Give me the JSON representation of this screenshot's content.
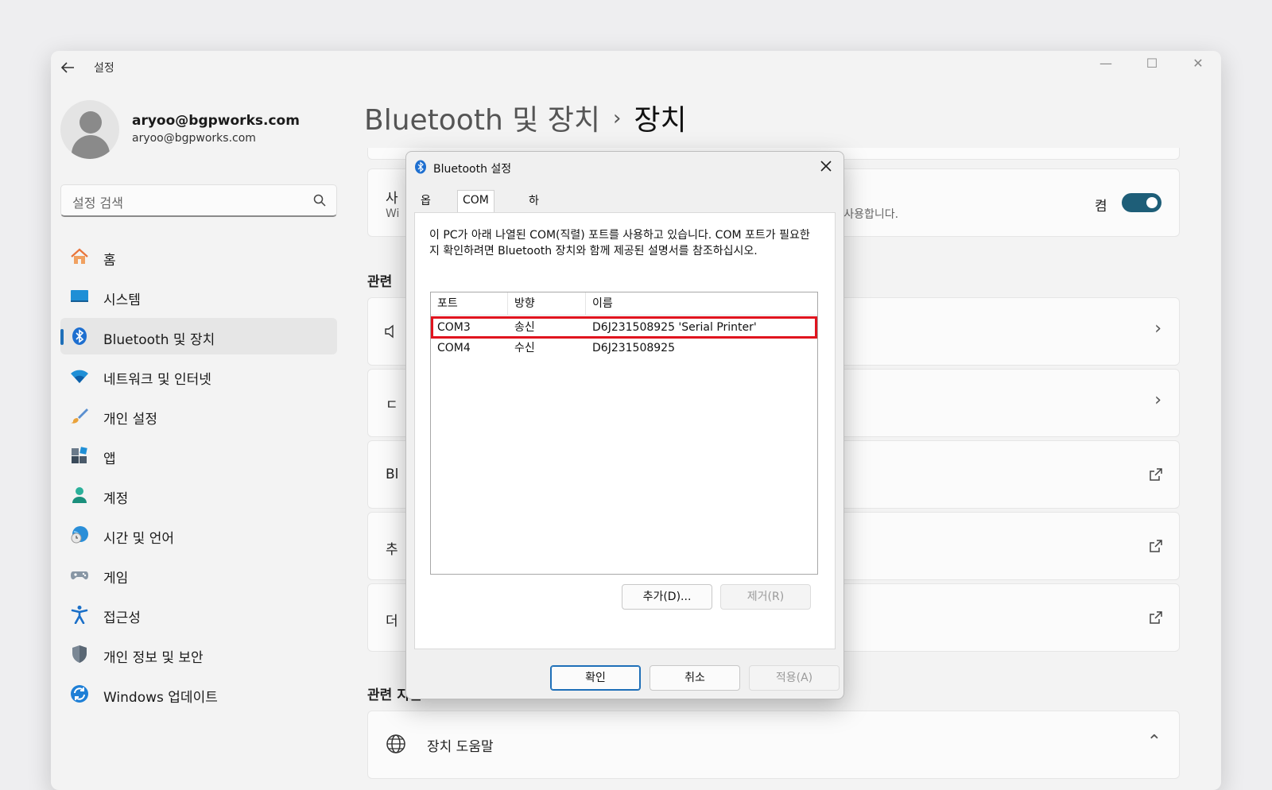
{
  "window": {
    "title": "설정",
    "minimize_glyph": "—",
    "maximize_glyph": "☐",
    "close_glyph": "✕"
  },
  "user": {
    "email": "aryoo@bgpworks.com",
    "sub_email": "aryoo@bgpworks.com"
  },
  "search": {
    "placeholder": "설정 검색"
  },
  "sidebar": {
    "items": [
      {
        "label": "홈",
        "icon": "home-icon"
      },
      {
        "label": "시스템",
        "icon": "system-icon"
      },
      {
        "label": "Bluetooth 및 장치",
        "icon": "bluetooth-icon",
        "active": true
      },
      {
        "label": "네트워크 및 인터넷",
        "icon": "wifi-icon"
      },
      {
        "label": "개인 설정",
        "icon": "brush-icon"
      },
      {
        "label": "앱",
        "icon": "apps-icon"
      },
      {
        "label": "계정",
        "icon": "account-icon"
      },
      {
        "label": "시간 및 언어",
        "icon": "globe-clock-icon"
      },
      {
        "label": "게임",
        "icon": "gamepad-icon"
      },
      {
        "label": "접근성",
        "icon": "accessibility-icon"
      },
      {
        "label": "개인 정보 및 보안",
        "icon": "shield-icon"
      },
      {
        "label": "Windows 업데이트",
        "icon": "update-icon"
      }
    ]
  },
  "breadcrumb": {
    "parent": "Bluetooth 및 장치",
    "separator": "›",
    "current": "장치"
  },
  "main": {
    "toggle_card": {
      "title_partial": "사",
      "sub_partial": "Wi",
      "sub_right": "오를 사용합니다.",
      "toggle_label": "켬",
      "toggle_on": true
    },
    "related_title_partial": "관련",
    "cards": [
      {
        "label_partial": "",
        "trail": "chevron-right"
      },
      {
        "label_partial": "ㄷ",
        "trail": "chevron-right"
      },
      {
        "label_partial": "Bl",
        "trail": "external-link"
      },
      {
        "label_partial": "추",
        "trail": "external-link"
      },
      {
        "label_partial": "더",
        "trail": "external-link"
      }
    ],
    "support_title": "관련 지원",
    "support_item": "장치 도움말"
  },
  "dialog": {
    "title": "Bluetooth 설정",
    "tabs": [
      "옵션",
      "COM 포트",
      "하드웨어"
    ],
    "active_tab": "COM 포트",
    "description": "이 PC가 아래 나열된 COM(직렬) 포트를 사용하고 있습니다. COM 포트가 필요한지 확인하려면 Bluetooth 장치와 함께 제공된 설명서를 참조하십시오.",
    "columns": [
      "포트",
      "방향",
      "이름"
    ],
    "rows": [
      {
        "port": "COM3",
        "direction": "송신",
        "name": "D6J231508925 'Serial Printer'",
        "highlighted": true
      },
      {
        "port": "COM4",
        "direction": "수신",
        "name": "D6J231508925",
        "highlighted": false
      }
    ],
    "add_button": "추가(D)...",
    "remove_button": "제거(R)",
    "ok_button": "확인",
    "cancel_button": "취소",
    "apply_button": "적용(A)"
  },
  "colors": {
    "accent": "#1e6fb8",
    "toggle": "#1e5e78",
    "highlight": "#e0141e"
  }
}
